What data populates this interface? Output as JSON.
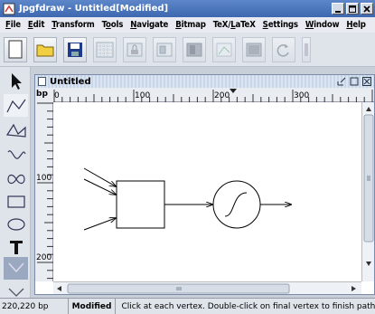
{
  "window": {
    "title": "Jpgfdraw - Untitled[Modified]"
  },
  "menu": [
    {
      "pre": "",
      "ul": "F",
      "post": "ile"
    },
    {
      "pre": "",
      "ul": "E",
      "post": "dit"
    },
    {
      "pre": "",
      "ul": "T",
      "post": "ransform"
    },
    {
      "pre": "T",
      "ul": "o",
      "post": "ols"
    },
    {
      "pre": "",
      "ul": "N",
      "post": "avigate"
    },
    {
      "pre": "",
      "ul": "B",
      "post": "itmap"
    },
    {
      "pre": "TeX/",
      "ul": "L",
      "post": "aTeX"
    },
    {
      "pre": "",
      "ul": "S",
      "post": "ettings"
    },
    {
      "pre": "",
      "ul": "W",
      "post": "indow"
    },
    {
      "pre": "",
      "ul": "H",
      "post": "elp"
    }
  ],
  "toolbar": {
    "icons": [
      "new-file-icon",
      "open-folder-icon",
      "save-disk-icon",
      "grid-icon",
      "lock-icon",
      "layers-icon",
      "dark-panel-icon",
      "construction-icon",
      "panel-icon",
      "rotate-icon",
      "more-icon"
    ]
  },
  "document": {
    "title": "Untitled",
    "unit": "bp"
  },
  "ruler": {
    "h": [
      "0",
      "100",
      "200",
      "300"
    ],
    "v": [
      "100",
      "200"
    ]
  },
  "status": {
    "coordinates": "220,220 bp",
    "mode": "Modified",
    "hint": "Click at each vertex. Double-click on final vertex to finish path."
  },
  "colors": {
    "titlebar": "#4a75bc",
    "selected_tool": "#9aa8c0"
  }
}
